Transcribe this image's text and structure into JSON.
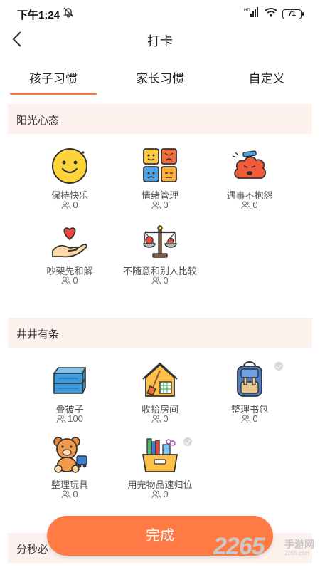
{
  "status_bar": {
    "time": "下午1:24",
    "battery": "71"
  },
  "header": {
    "title": "打卡"
  },
  "tabs": [
    {
      "label": "孩子习惯",
      "active": true
    },
    {
      "label": "家长习惯",
      "active": false
    },
    {
      "label": "自定义",
      "active": false
    }
  ],
  "sections": [
    {
      "title": "阳光心态"
    },
    {
      "title": "井井有条"
    },
    {
      "title": "分秒必"
    }
  ],
  "habits": [
    {
      "label": "保持快乐",
      "count": "0",
      "icon": "smiley-face-icon"
    },
    {
      "label": "情绪管理",
      "count": "0",
      "icon": "emotion-faces-icon"
    },
    {
      "label": "遇事不抱怨",
      "count": "0",
      "icon": "angry-cloud-icon"
    },
    {
      "label": "吵架先和解",
      "count": "0",
      "icon": "heart-in-hand-icon"
    },
    {
      "label": "不随意和别人比较",
      "count": "0",
      "icon": "balance-scale-icon"
    },
    {
      "label": "叠被子",
      "count": "100",
      "icon": "folded-quilt-icon"
    },
    {
      "label": "收拾房间",
      "count": "0",
      "icon": "house-broom-icon"
    },
    {
      "label": "整理书包",
      "count": "0",
      "icon": "backpack-icon"
    },
    {
      "label": "整理玩具",
      "count": "0",
      "icon": "teddy-bear-icon"
    },
    {
      "label": "用完物品速归位",
      "count": "0",
      "icon": "storage-box-icon"
    }
  ],
  "done_button": {
    "label": "完成"
  },
  "watermark": {
    "number": "2265",
    "text": "手游网",
    "url": "2265.com"
  },
  "colors": {
    "accent": "#ff7a45",
    "section_bg": "#fdf1ee",
    "tab_underline": "#f07a4a"
  }
}
